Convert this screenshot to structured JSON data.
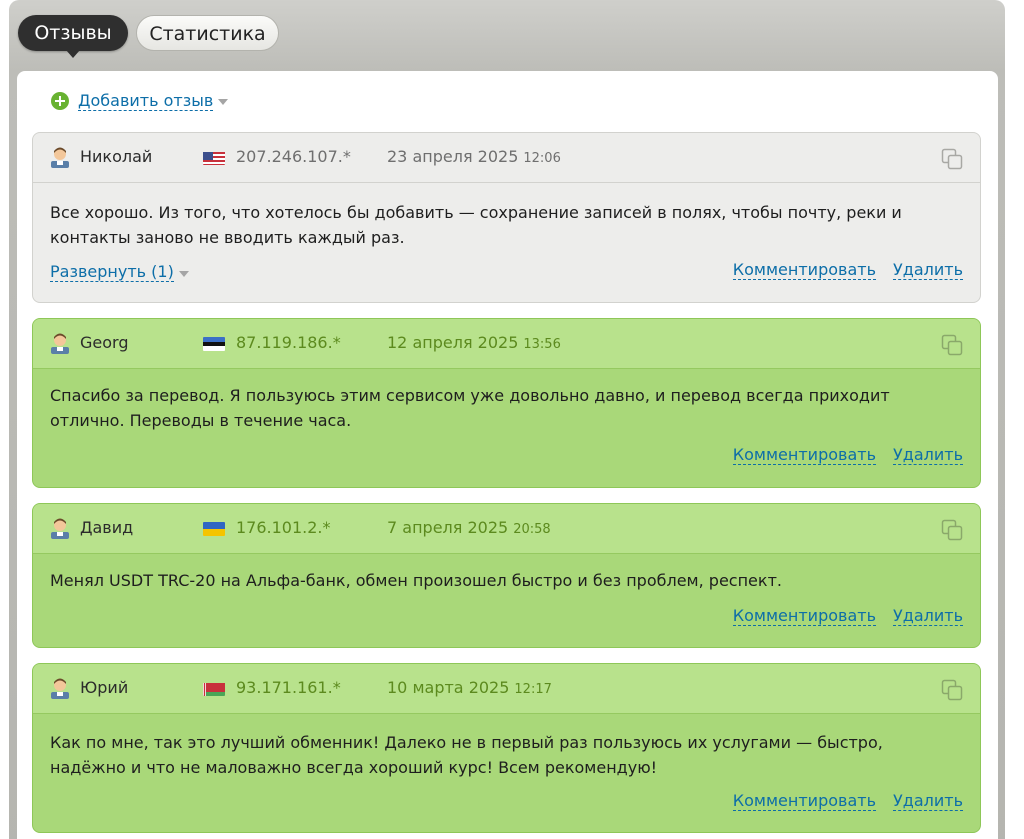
{
  "tabs": [
    {
      "label": "Отзывы",
      "active": true
    },
    {
      "label": "Статистика",
      "active": false
    }
  ],
  "add_review": {
    "label": "Добавить отзыв",
    "icon": "plus-circle-icon"
  },
  "actions": {
    "comment": "Комментировать",
    "delete": "Удалить"
  },
  "reviews": [
    {
      "style": "neutral",
      "user": "Николай",
      "flag": "us",
      "ip": "207.246.107.*",
      "date": "23 апреля 2025",
      "time": "12:06",
      "text": "Все хорошо. Из того, что хотелось бы добавить — сохранение записей в полях, чтобы почту, реки и контакты заново не вводить каждый раз.",
      "expand": "Развернуть (1)"
    },
    {
      "style": "positive",
      "user": "Georg",
      "flag": "ee",
      "ip": "87.119.186.*",
      "date": "12 апреля 2025",
      "time": "13:56",
      "text": "Спасибо за перевод. Я пользуюсь этим сервисом уже довольно давно, и перевод всегда приходит отлично. Переводы в течение часа."
    },
    {
      "style": "positive",
      "user": "Давид",
      "flag": "ua",
      "ip": "176.101.2.*",
      "date": "7 апреля 2025",
      "time": "20:58",
      "text": "Менял USDT TRC-20 на Альфа-банк, обмен произошел быстро и без проблем, респект."
    },
    {
      "style": "positive",
      "user": "Юрий",
      "flag": "by",
      "ip": "93.171.161.*",
      "date": "10 марта 2025",
      "time": "12:17",
      "text": "Как по мне, так это лучший обменник! Далеко не в первый раз пользуюсь их услугами — быстро, надёжно и что не маловажно всегда хороший курс! Всем рекомендую!"
    }
  ],
  "colors": {
    "neutral_bg": "#ededeb",
    "positive_bg": "#a9d879",
    "link": "#0d6ea8",
    "tab_active": "#2f2f2f"
  }
}
